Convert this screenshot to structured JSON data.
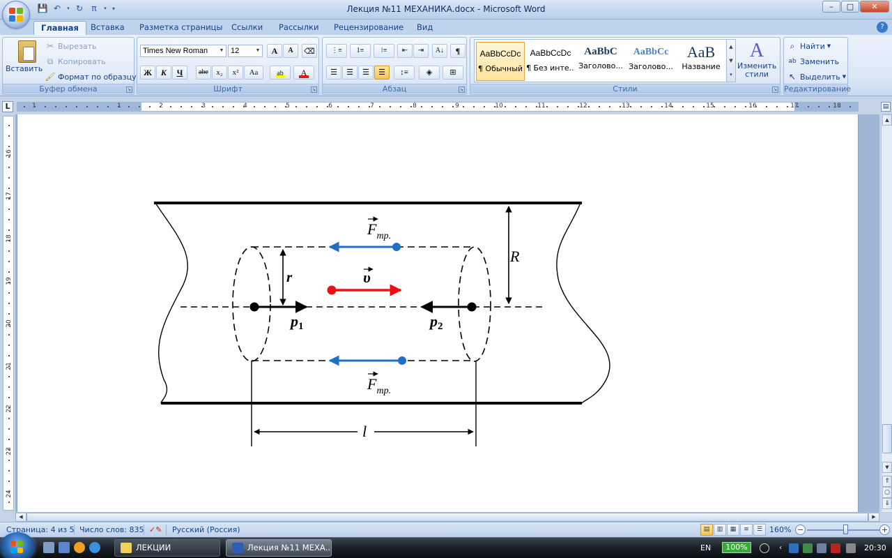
{
  "window": {
    "title": "Лекция №11 МЕХАНИКА.docx - Microsoft Word",
    "controls": {
      "minimize": "–",
      "maximize": "□",
      "close": "✕"
    }
  },
  "tabs": [
    "Главная",
    "Вставка",
    "Разметка страницы",
    "Ссылки",
    "Рассылки",
    "Рецензирование",
    "Вид"
  ],
  "active_tab": "Главная",
  "ribbon": {
    "clipboard": {
      "label": "Буфер обмена",
      "paste": "Вставить",
      "cut": "Вырезать",
      "copy": "Копировать",
      "format_painter": "Формат по образцу"
    },
    "font": {
      "label": "Шрифт",
      "font_name": "Times New Roman",
      "font_size": "12",
      "bold": "Ж",
      "italic": "К",
      "underline": "Ч",
      "strike": "abe",
      "subscript": "x₂",
      "superscript": "x²",
      "change_case": "Aa",
      "grow": "A",
      "shrink": "A"
    },
    "paragraph": {
      "label": "Абзац",
      "pilcrow": "¶"
    },
    "styles": {
      "label": "Стили",
      "items": [
        {
          "sample": "AaBbCcDc",
          "name": "¶ Обычный"
        },
        {
          "sample": "AaBbCcDc",
          "name": "¶ Без инте..."
        },
        {
          "sample": "AaBbC",
          "name": "Заголово..."
        },
        {
          "sample": "AaBbCc",
          "name": "Заголово..."
        },
        {
          "sample": "AaB",
          "name": "Название"
        }
      ],
      "change_styles": "Изменить стили"
    },
    "editing": {
      "label": "Редактирование",
      "find": "Найти",
      "replace": "Заменить",
      "select": "Выделить"
    }
  },
  "ruler": {
    "h_numbers": [
      "1",
      "1",
      "2",
      "3",
      "4",
      "5",
      "6",
      "7",
      "8",
      "9",
      "10",
      "11",
      "12",
      "13",
      "14",
      "15",
      "16",
      "17",
      "18"
    ],
    "v_numbers": [
      "16",
      "17",
      "18",
      "19",
      "20",
      "21",
      "22",
      "23",
      "24"
    ]
  },
  "diagram": {
    "labels": {
      "force_top": "F",
      "force_top_sub": "тр.",
      "force_bottom": "F",
      "force_bottom_sub": "тр.",
      "velocity": "υ",
      "radius_outer": "R",
      "radius_inner": "r",
      "pressure_1": "p",
      "pressure_1_sub": "1",
      "pressure_2": "p",
      "pressure_2_sub": "2",
      "length": "l"
    },
    "colors": {
      "friction": "#1f6fc5",
      "velocity": "#ee1111",
      "lines": "#000000"
    }
  },
  "statusbar": {
    "page": "Страница: 4 из 5",
    "words": "Число слов: 835",
    "language": "Русский (Россия)",
    "zoom": "160%"
  },
  "taskbar": {
    "buttons": [
      "ЛЕКЦИИ",
      "Лекция №11 МЕХА..."
    ],
    "lang": "EN",
    "battery": "100%",
    "time": "20:30"
  }
}
